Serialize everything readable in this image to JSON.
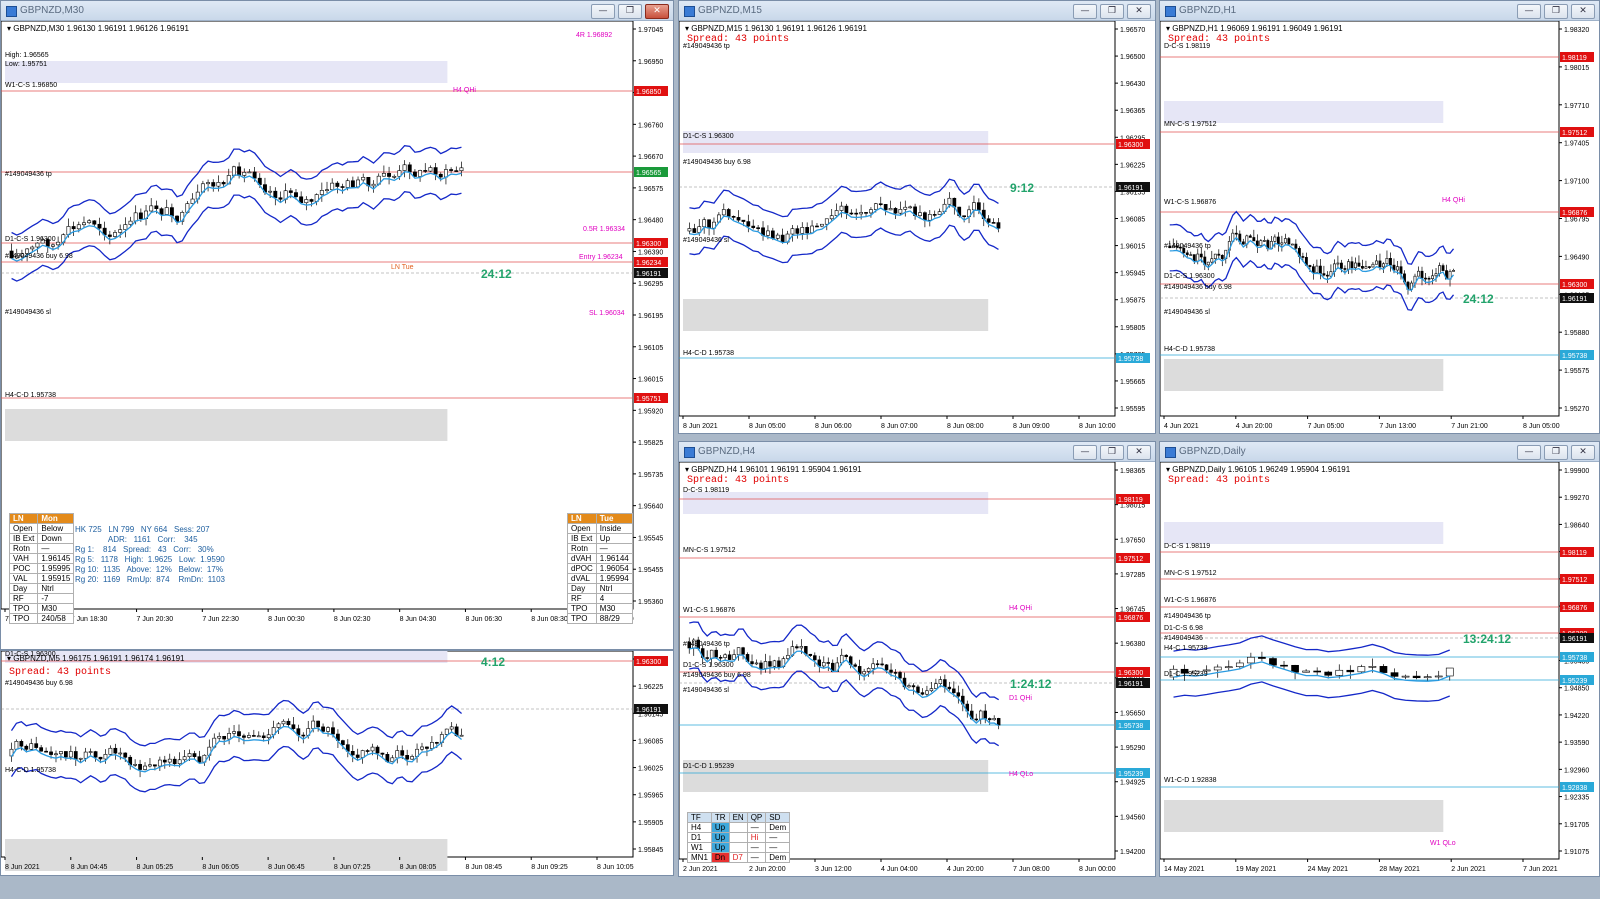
{
  "colors": {
    "resistance_tag": "#e01010",
    "current_tag": "#101010",
    "support_tag": "#2aa9d8",
    "timer": "#22a36b",
    "spread": "#e00000"
  },
  "win_controls": [
    "—",
    "❐",
    "✕"
  ],
  "windows": {
    "m30": {
      "title": "GBPNZD,M30",
      "header": "▾  GBPNZD,M30  1.96130 1.96191 1.96126 1.96191",
      "timer": "24:12",
      "y_ticks": [
        "1.97045",
        "1.96950",
        "1.96850",
        "1.96760",
        "1.96670",
        "1.96575",
        "1.96480",
        "1.96390",
        "1.96295",
        "1.96195",
        "1.96105",
        "1.96015",
        "1.95920",
        "1.95825",
        "1.95735",
        "1.95640",
        "1.95545",
        "1.95455",
        "1.95360"
      ],
      "x_ticks": [
        "7 Jun 2021",
        "7 Jun 18:30",
        "7 Jun 20:30",
        "7 Jun 22:30",
        "8 Jun 00:30",
        "8 Jun 02:30",
        "8 Jun 04:30",
        "8 Jun 06:30",
        "8 Jun 08:30",
        "8 Jun 10:30"
      ],
      "price_tags": [
        {
          "text": "1.96850",
          "kind": "r"
        },
        {
          "text": "1.96565",
          "kind": "g"
        },
        {
          "text": "1.96300",
          "kind": "r"
        },
        {
          "text": "1.96234",
          "kind": "r"
        },
        {
          "text": "1.96191",
          "kind": "c"
        },
        {
          "text": "1.95751",
          "kind": "r"
        }
      ],
      "labels": [
        "High: 1.96565",
        "Low: 1.95751",
        "W1-C-S 1.96850",
        "H4 QHi",
        "#149049436 tp",
        "D1-C-S 1.96300",
        "#149049436 buy 6.98",
        "LN Tue",
        "#149049436 sl",
        "H4-C-D 1.95738",
        "0.5R 1.96334",
        "Entry 1.96234",
        "SL 1.96034",
        "4R 1.96892"
      ],
      "table_left": {
        "head": [
          "LN",
          "Mon"
        ],
        "rows": [
          [
            "Open",
            "Below"
          ],
          [
            "IB Ext",
            "Down"
          ],
          [
            "Rotn",
            "—"
          ],
          [
            "VAH",
            "1.96145"
          ],
          [
            "POC",
            "1.95995"
          ],
          [
            "VAL",
            "1.95915"
          ],
          [
            "Day",
            "Ntrl"
          ],
          [
            "RF",
            "-7"
          ],
          [
            "TPO",
            "M30"
          ],
          [
            "TPO",
            "240/58"
          ]
        ]
      },
      "table_right": {
        "head": [
          "LN",
          "Tue"
        ],
        "rows": [
          [
            "Open",
            "Inside"
          ],
          [
            "IB Ext",
            "Up"
          ],
          [
            "Rotn",
            "—"
          ],
          [
            "dVAH",
            "1.96144"
          ],
          [
            "dPOC",
            "1.96054"
          ],
          [
            "dVAL",
            "1.95994"
          ],
          [
            "Day",
            "Ntrl"
          ],
          [
            "RF",
            "4"
          ],
          [
            "TPO",
            "M30"
          ],
          [
            "TPO",
            "88/29"
          ]
        ]
      },
      "stats": [
        "HK 725   LN 799   NY 664   Sess: 207",
        "               ADR:   1161   Corr:    345",
        "Rg 1:    814   Spread:   43   Corr:   30%",
        "Rg 5:   1178   High:  1.9625   Low:  1.9590",
        "Rg 10:  1135   Above:  12%   Below:  17%",
        "Rg 20:  1169   RmUp:  874    RmDn:  1103"
      ]
    },
    "m5": {
      "header": "▾  GBPNZD,M5  1.96175 1.96191 1.96174 1.96191",
      "spread": "Spread: 43 points",
      "timer": "4:12",
      "y_ticks": [
        "1.96285",
        "1.96225",
        "1.96145",
        "1.96085",
        "1.96025",
        "1.95965",
        "1.95905",
        "1.95845"
      ],
      "x_ticks": [
        "8 Jun 2021",
        "8 Jun 04:45",
        "8 Jun 05:25",
        "8 Jun 06:05",
        "8 Jun 06:45",
        "8 Jun 07:25",
        "8 Jun 08:05",
        "8 Jun 08:45",
        "8 Jun 09:25",
        "8 Jun 10:05"
      ],
      "price_tags": [
        {
          "text": "1.96300",
          "kind": "r"
        },
        {
          "text": "1.96191",
          "kind": "c"
        }
      ],
      "labels": [
        "D1-C-S 1.96300",
        "#149049436 buy 6.98",
        "H4-C-D 1.95738"
      ]
    },
    "m15": {
      "title": "GBPNZD,M15",
      "header": "▾  GBPNZD,M15  1.96130 1.96191 1.96126 1.96191",
      "spread": "Spread: 43 points",
      "timer": "9:12",
      "y_ticks": [
        "1.96570",
        "1.96500",
        "1.96430",
        "1.96365",
        "1.96295",
        "1.96225",
        "1.96155",
        "1.96085",
        "1.96015",
        "1.95945",
        "1.95875",
        "1.95805",
        "1.95735",
        "1.95665",
        "1.95595"
      ],
      "x_ticks": [
        "8 Jun 2021",
        "8 Jun 05:00",
        "8 Jun 06:00",
        "8 Jun 07:00",
        "8 Jun 08:00",
        "8 Jun 09:00",
        "8 Jun 10:00"
      ],
      "price_tags": [
        {
          "text": "1.96300",
          "kind": "r"
        },
        {
          "text": "1.96191",
          "kind": "c"
        },
        {
          "text": "1.95738",
          "kind": "s"
        }
      ],
      "labels": [
        "#149049436 tp",
        "D1-C-S 1.96300",
        "#149049436 buy 6.98",
        "#149049436 sl",
        "H4-C-D 1.95738"
      ]
    },
    "h1": {
      "title": "GBPNZD,H1",
      "header": "▾  GBPNZD,H1  1.96069 1.96191 1.96049 1.96191",
      "spread": "Spread: 43 points",
      "timer": "24:12",
      "y_ticks": [
        "1.98320",
        "1.98015",
        "1.97710",
        "1.97405",
        "1.97100",
        "1.96795",
        "1.96490",
        "1.96185",
        "1.95880",
        "1.95575",
        "1.95270"
      ],
      "x_ticks": [
        "4 Jun 2021",
        "4 Jun 20:00",
        "7 Jun 05:00",
        "7 Jun 13:00",
        "7 Jun 21:00",
        "8 Jun 05:00"
      ],
      "price_tags": [
        {
          "text": "1.98119",
          "kind": "r"
        },
        {
          "text": "1.97512",
          "kind": "r"
        },
        {
          "text": "1.96876",
          "kind": "r"
        },
        {
          "text": "1.96300",
          "kind": "r"
        },
        {
          "text": "1.96191",
          "kind": "c"
        },
        {
          "text": "1.95738",
          "kind": "s"
        }
      ],
      "labels": [
        "D-C-S 1.98119",
        "MN-C-S 1.97512",
        "W1-C-S 1.96876",
        "H4 QHi",
        "#149049436 tp",
        "D1-C-S 1.96300",
        "#149049436 buy 6.98",
        "#149049436 sl",
        "H4-C-D 1.95738"
      ]
    },
    "h4": {
      "title": "GBPNZD,H4",
      "header": "▾  GBPNZD,H4  1.96101 1.96191 1.95904 1.96191",
      "spread": "Spread: 43 points",
      "timer": "1:24:12",
      "y_ticks": [
        "1.98365",
        "1.98015",
        "1.97650",
        "1.97285",
        "1.96745",
        "1.96380",
        "1.96015",
        "1.95650",
        "1.95290",
        "1.94925",
        "1.94560",
        "1.94200"
      ],
      "x_ticks": [
        "2 Jun 2021",
        "2 Jun 20:00",
        "3 Jun 12:00",
        "4 Jun 04:00",
        "4 Jun 20:00",
        "7 Jun 08:00",
        "8 Jun 00:00"
      ],
      "price_tags": [
        {
          "text": "1.98119",
          "kind": "r"
        },
        {
          "text": "1.97512",
          "kind": "r"
        },
        {
          "text": "1.96876",
          "kind": "r"
        },
        {
          "text": "1.96300",
          "kind": "r"
        },
        {
          "text": "1.96191",
          "kind": "c"
        },
        {
          "text": "1.95738",
          "kind": "s"
        },
        {
          "text": "1.95239",
          "kind": "s"
        }
      ],
      "labels": [
        "D-C-S 1.98119",
        "MN-C-S 1.97512",
        "W1-C-S 1.96876",
        "H4 QHi",
        "#149049436 tp",
        "D1-C-S 1.96300",
        "#149049436 buy 6.98",
        "#149049436 sl",
        "D1 QHi",
        "D1-C-D 1.95239",
        "H4 QLo"
      ],
      "trend_table": {
        "head": [
          "TF",
          "TR",
          "EN",
          "QP",
          "SD"
        ],
        "rows": [
          [
            "H4",
            "Up",
            "",
            "—",
            "Dem"
          ],
          [
            "D1",
            "Up",
            "",
            "Hi",
            "—"
          ],
          [
            "W1",
            "Up",
            "",
            "—",
            "—"
          ],
          [
            "MN1",
            "Dn",
            "D7",
            "—",
            "Dem"
          ]
        ]
      }
    },
    "daily": {
      "title": "GBPNZD,Daily",
      "header": "▾  GBPNZD,Daily  1.96105 1.96249 1.95904 1.96191",
      "spread": "Spread: 43 points",
      "timer": "13:24:12",
      "y_ticks": [
        "1.99900",
        "1.99270",
        "1.98640",
        "1.98005",
        "1.97375",
        "1.96745",
        "1.96115",
        "1.95485",
        "1.94850",
        "1.94220",
        "1.93590",
        "1.92960",
        "1.92335",
        "1.91705",
        "1.91075"
      ],
      "x_ticks": [
        "14 May 2021",
        "19 May 2021",
        "24 May 2021",
        "28 May 2021",
        "2 Jun 2021",
        "7 Jun 2021"
      ],
      "price_tags": [
        {
          "text": "1.98119",
          "kind": "r"
        },
        {
          "text": "1.97512",
          "kind": "r"
        },
        {
          "text": "1.96876",
          "kind": "r"
        },
        {
          "text": "1.96300",
          "kind": "r"
        },
        {
          "text": "1.96191",
          "kind": "c"
        },
        {
          "text": "1.95738",
          "kind": "s"
        },
        {
          "text": "1.95239",
          "kind": "s"
        },
        {
          "text": "1.92838",
          "kind": "s"
        }
      ],
      "labels": [
        "D-C-S 1.98119",
        "MN-C-S 1.97512",
        "W1-C-S 1.96876",
        "#149049436 tp",
        "D1-C-S 6.98",
        "#149049436",
        "H4-C 1.95738",
        "D1-C 1.95239",
        "W1-C-D 1.92838",
        "W1 QLo"
      ]
    }
  }
}
